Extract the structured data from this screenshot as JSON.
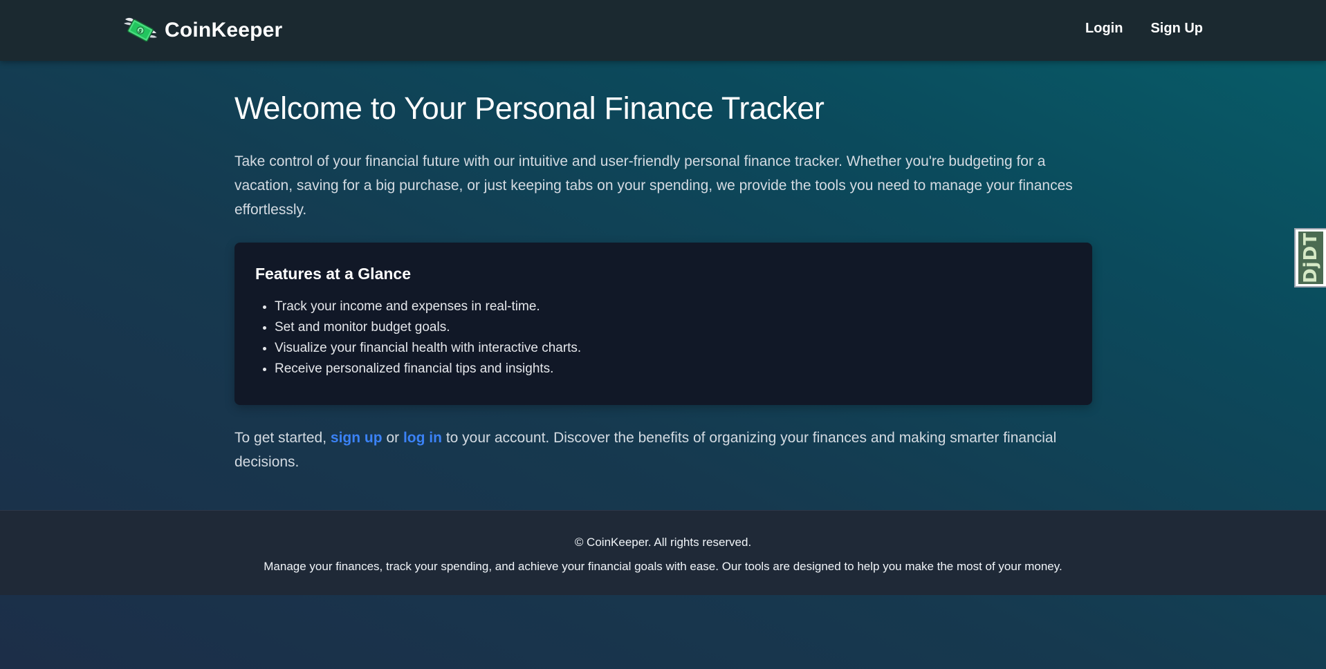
{
  "navbar": {
    "brand": "CoinKeeper",
    "brand_icon": "money-with-wings-icon",
    "login_label": "Login",
    "signup_label": "Sign Up"
  },
  "main": {
    "title": "Welcome to Your Personal Finance Tracker",
    "intro": "Take control of your financial future with our intuitive and user-friendly personal finance tracker. Whether you're budgeting for a vacation, saving for a big purchase, or just keeping tabs on your spending, we provide the tools you need to manage your finances effortlessly.",
    "features": {
      "title": "Features at a Glance",
      "items": [
        "Track your income and expenses in real-time.",
        "Set and monitor budget goals.",
        "Visualize your financial health with interactive charts.",
        "Receive personalized financial tips and insights."
      ]
    },
    "cta": {
      "prefix": "To get started,",
      "signup_link": "sign up",
      "or": "or",
      "login_link": "log in",
      "suffix": "to your account. Discover the benefits of organizing your finances and making smarter financial decisions."
    }
  },
  "footer": {
    "copyright": "© CoinKeeper. All rights reserved.",
    "tagline": "Manage your finances, track your spending, and achieve your financial goals with ease. Our tools are designed to help you make the most of your money."
  },
  "debug_toolbar": {
    "label": "DjDT"
  },
  "colors": {
    "navbar_bg": "#1b2930",
    "card_bg": "#111827",
    "footer_bg": "#1f2937",
    "link": "#3b82f6",
    "gradient_top": "#075f6a",
    "gradient_bottom": "#1c2e48"
  }
}
